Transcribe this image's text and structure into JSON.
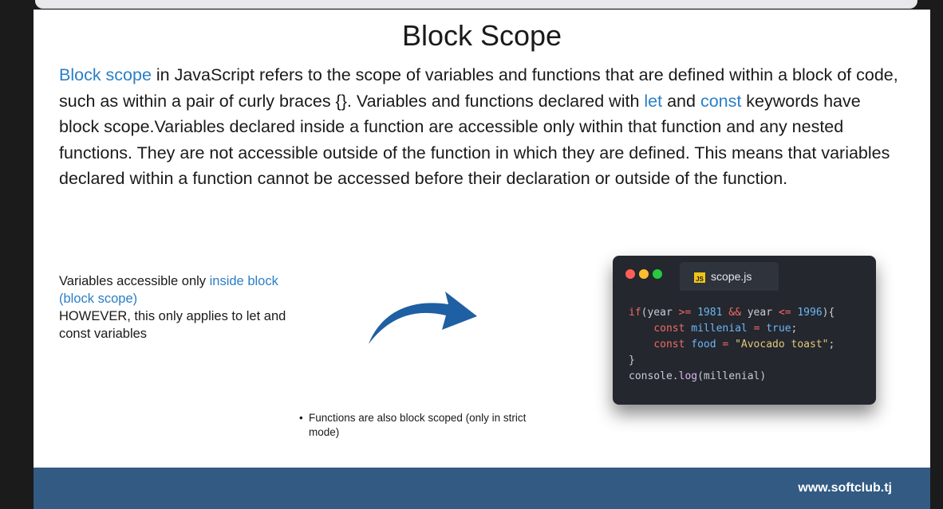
{
  "slide": {
    "title": "Block Scope",
    "intro": {
      "highlight_term": "Block scope",
      "part1": " in JavaScript refers to the scope of variables and functions that are defined within a block of code, such as within a pair of curly braces {}. Variables and functions declared with ",
      "kw_let": "let",
      "and_word": " and ",
      "kw_const": "const",
      "part2": " keywords have block scope.Variables declared inside a function are accessible only within that function and any nested functions. They are not accessible outside of the function in which they are defined. This means that variables declared within a function cannot be accessed before their declaration or outside of the function."
    },
    "note": {
      "text1": "Variables  accessible only ",
      "highlight": "inside block (block scope)",
      "text2": "HOWEVER, this only applies to let and const variables"
    },
    "bullet": "Functions are also block scoped (only in strict mode)",
    "editor": {
      "filename": "scope.js",
      "badge": "JS",
      "dot_colors": [
        "#ff5f56",
        "#ffbd2e",
        "#27c93f"
      ]
    },
    "footer": "www.softclub.tj"
  },
  "colors": {
    "highlight": "#2a7fc7",
    "footer_bg": "#325a82",
    "arrow": "#1f5fa3"
  }
}
